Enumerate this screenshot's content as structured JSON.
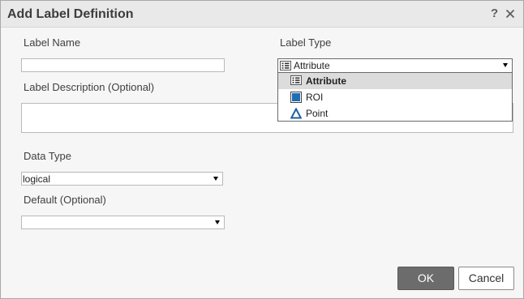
{
  "dialog": {
    "title": "Add Label Definition",
    "help_glyph": "?",
    "close_icon": "close-icon"
  },
  "form": {
    "label_name": {
      "label": "Label Name",
      "value": ""
    },
    "label_type": {
      "label": "Label Type",
      "selected": "Attribute",
      "selected_icon": "attribute-list-icon",
      "options": [
        {
          "label": "Attribute",
          "icon": "attribute-list-icon",
          "highlighted": true
        },
        {
          "label": "ROI",
          "icon": "roi-square-icon",
          "highlighted": false
        },
        {
          "label": "Point",
          "icon": "point-triangle-icon",
          "highlighted": false
        }
      ]
    },
    "label_description": {
      "label": "Label Description (Optional)",
      "value": ""
    },
    "data_type": {
      "label": "Data Type",
      "selected": "logical"
    },
    "default": {
      "label": "Default (Optional)",
      "selected": ""
    }
  },
  "buttons": {
    "ok": "OK",
    "cancel": "Cancel"
  },
  "colors": {
    "ok_bg": "#6c6c6c",
    "highlight_bg": "#dcdcdc",
    "roi_blue": "#1f6eb3",
    "point_blue": "#1f5f9e"
  }
}
